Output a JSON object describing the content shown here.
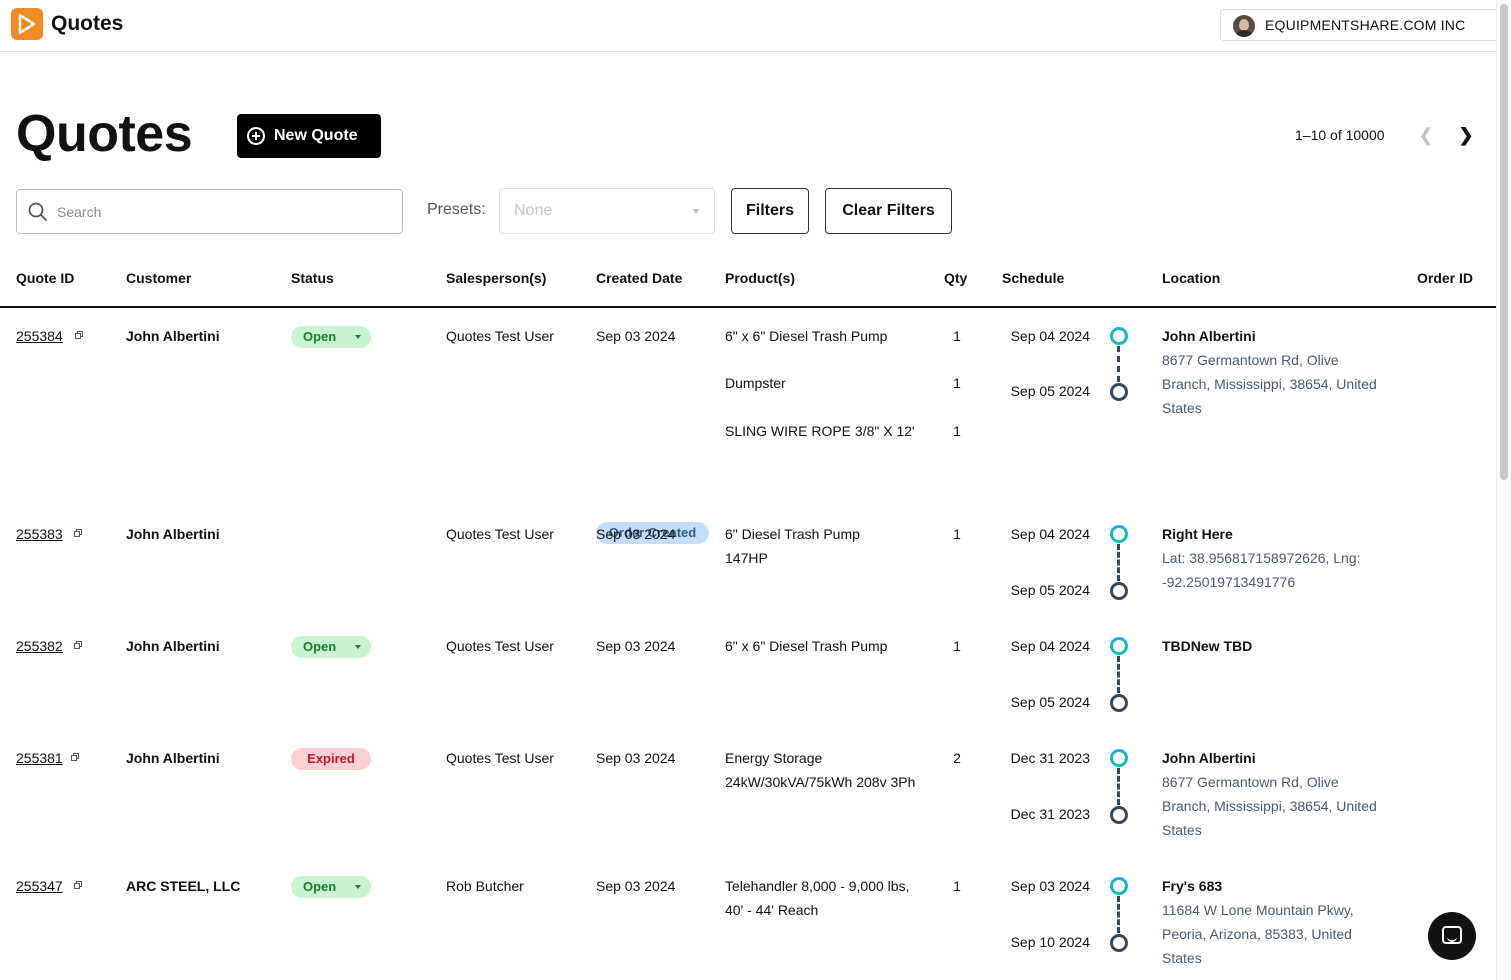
{
  "header": {
    "app_title": "Quotes",
    "account_name": "EQUIPMENTSHARE.COM INC",
    "brand_color": "#f08a24"
  },
  "page": {
    "title": "Quotes",
    "new_quote_label": "New Quote",
    "pagination": "1–10 of 10000"
  },
  "filters": {
    "search_placeholder": "Search",
    "presets_label": "Presets:",
    "presets_value": "None",
    "filters_label": "Filters",
    "clear_filters_label": "Clear Filters"
  },
  "columns": [
    "Quote ID",
    "Customer",
    "Status",
    "Salesperson(s)",
    "Created Date",
    "Product(s)",
    "Qty",
    "Schedule",
    "Location",
    "Order ID"
  ],
  "status_colors": {
    "open": "#1b7a35",
    "order_created": "#2f5d8a",
    "expired": "#c2182b"
  },
  "rows": [
    {
      "quote_id": "255384",
      "customer": "John Albertini",
      "status": "Open",
      "salesperson": "Quotes Test User",
      "created": "Sep 03 2024",
      "products": [
        {
          "name": "6\" x 6\" Diesel Trash Pump",
          "qty": "1"
        },
        {
          "name": "Dumpster",
          "qty": "1"
        },
        {
          "name": "SLING WIRE ROPE 3/8\" X 12'",
          "qty": "1"
        }
      ],
      "schedule_start": "Sep 04 2024",
      "schedule_end": "Sep 05 2024",
      "location_name": "John Albertini",
      "location_address": "8677 Germantown Rd, Olive Branch, Mississippi, 38654, United States"
    },
    {
      "quote_id": "255383",
      "customer": "John Albertini",
      "status": "Order Created",
      "salesperson": "Quotes Test User",
      "created": "Sep 03 2024",
      "products": [
        {
          "name": "6\" Diesel Trash Pump 147HP",
          "qty": "1"
        }
      ],
      "schedule_start": "Sep 04 2024",
      "schedule_end": "Sep 05 2024",
      "location_name": "Right Here",
      "location_address": "Lat: 38.956817158972626, Lng: -92.25019713491776"
    },
    {
      "quote_id": "255382",
      "customer": "John Albertini",
      "status": "Open",
      "salesperson": "Quotes Test User",
      "created": "Sep 03 2024",
      "products": [
        {
          "name": "6\" x 6\" Diesel Trash Pump",
          "qty": "1"
        }
      ],
      "schedule_start": "Sep 04 2024",
      "schedule_end": "Sep 05 2024",
      "location_name": "TBDNew TBD",
      "location_address": ""
    },
    {
      "quote_id": "255381",
      "customer": "John Albertini",
      "status": "Expired",
      "salesperson": "Quotes Test User",
      "created": "Sep 03 2024",
      "products": [
        {
          "name": "Energy Storage 24kW/30kVA/75kWh 208v 3Ph",
          "qty": "2"
        }
      ],
      "schedule_start": "Dec 31 2023",
      "schedule_end": "Dec 31 2023",
      "location_name": "John Albertini",
      "location_address": "8677 Germantown Rd, Olive Branch, Mississippi, 38654, United States"
    },
    {
      "quote_id": "255347",
      "customer": "ARC STEEL, LLC",
      "status": "Open",
      "salesperson": "Rob Butcher",
      "created": "Sep 03 2024",
      "products": [
        {
          "name": "Telehandler 8,000 - 9,000 lbs, 40' - 44' Reach",
          "qty": "1"
        }
      ],
      "schedule_start": "Sep 03 2024",
      "schedule_end": "Sep 10 2024",
      "location_name": "Fry's 683",
      "location_address": "11684 W Lone Mountain Pkwy, Peoria, Arizona, 85383, United States"
    }
  ]
}
